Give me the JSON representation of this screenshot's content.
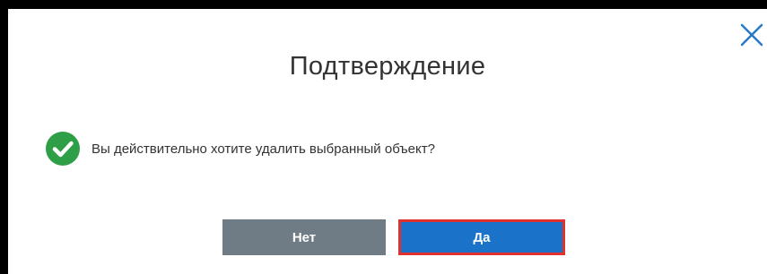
{
  "dialog": {
    "title": "Подтверждение",
    "message": "Вы действительно хотите удалить выбранный объект?",
    "no_label": "Нет",
    "yes_label": "Да"
  },
  "icons": {
    "close": "close-icon",
    "status": "check-circle-icon"
  },
  "colors": {
    "success": "#2e9e47",
    "close": "#2a78c8",
    "no_button": "#6f7c86",
    "yes_button": "#1a73c8",
    "highlight_border": "#e0322d"
  }
}
